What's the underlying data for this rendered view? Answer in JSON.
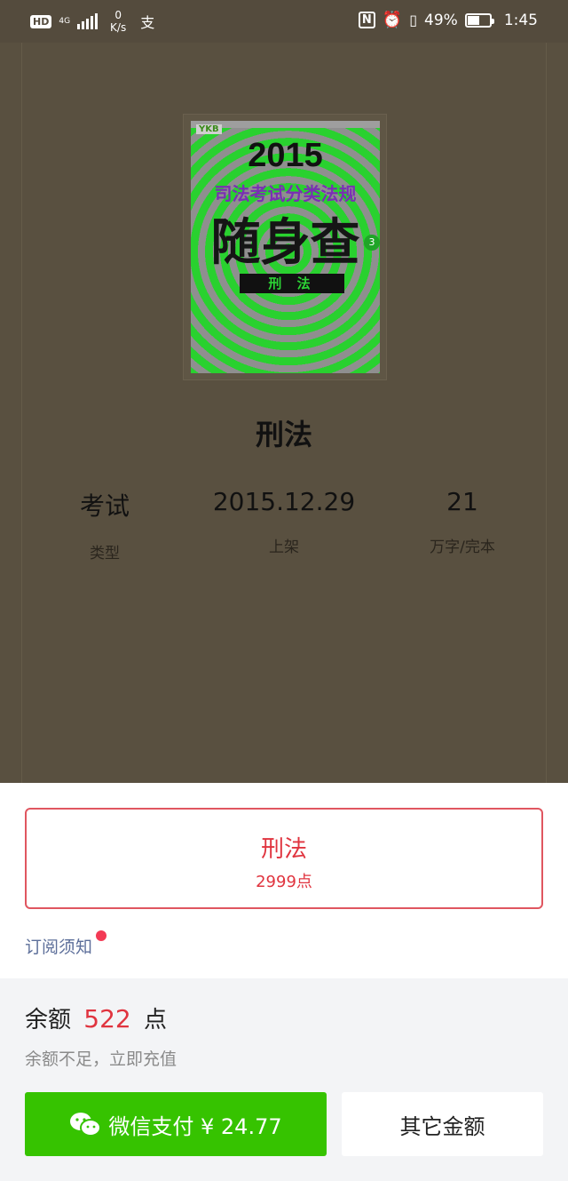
{
  "status_bar": {
    "hd": "HD",
    "network": "4G",
    "speed_value": "0",
    "speed_unit": "K/s",
    "alipay_glyph": "支",
    "nfc": "N",
    "battery_percent": "49%",
    "battery_level": 0.49,
    "time": "1:45"
  },
  "book": {
    "cover": {
      "logo": "YKB",
      "year": "2015",
      "subtitle": "司法考试分类法规",
      "big_title": "随身查",
      "band": "刑 法",
      "number": "3"
    },
    "title": "刑法",
    "meta": [
      {
        "value": "考试",
        "label": "类型"
      },
      {
        "value": "2015.12.29",
        "label": "上架"
      },
      {
        "value": "21",
        "label": "万字/完本"
      }
    ]
  },
  "purchase": {
    "item_name": "刑法",
    "item_price": "2999点",
    "notice_link": "订阅须知"
  },
  "payment": {
    "balance_label": "余额",
    "balance_amount": "522",
    "balance_unit": "点",
    "insufficient_text": "余额不足，立即充值",
    "wechat_button": "微信支付 ¥ 24.77",
    "other_button": "其它金额",
    "colors": {
      "accent_red": "#e0343f",
      "wechat_green": "#36c300"
    }
  }
}
